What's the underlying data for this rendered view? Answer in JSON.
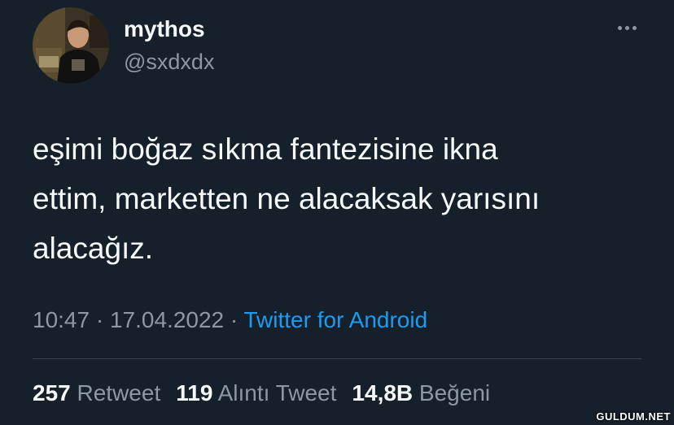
{
  "user": {
    "display_name": "mythos",
    "handle": "@sxdxdx",
    "avatar_icon": "profile-photo"
  },
  "more_icon": "ellipsis-icon",
  "tweet": {
    "text": "eşimi boğaz sıkma fantezisine ikna\nettim, marketten ne alacaksak yarısını\nalacağız.",
    "time": "10:47",
    "separator1": " · ",
    "date": "17.04.2022",
    "separator2": " · ",
    "source": "Twitter for Android"
  },
  "stats": {
    "retweets": {
      "count": "257",
      "label": "Retweet"
    },
    "quotes": {
      "count": "119",
      "label": "Alıntı Tweet"
    },
    "likes": {
      "count": "14,8B",
      "label": "Beğeni"
    }
  },
  "watermark": "GULDUM.NET",
  "colors": {
    "background": "#15202b",
    "text_primary": "#f7f9f9",
    "text_secondary": "#8b98a5",
    "link": "#1d9bf0",
    "divider": "#38444d"
  }
}
